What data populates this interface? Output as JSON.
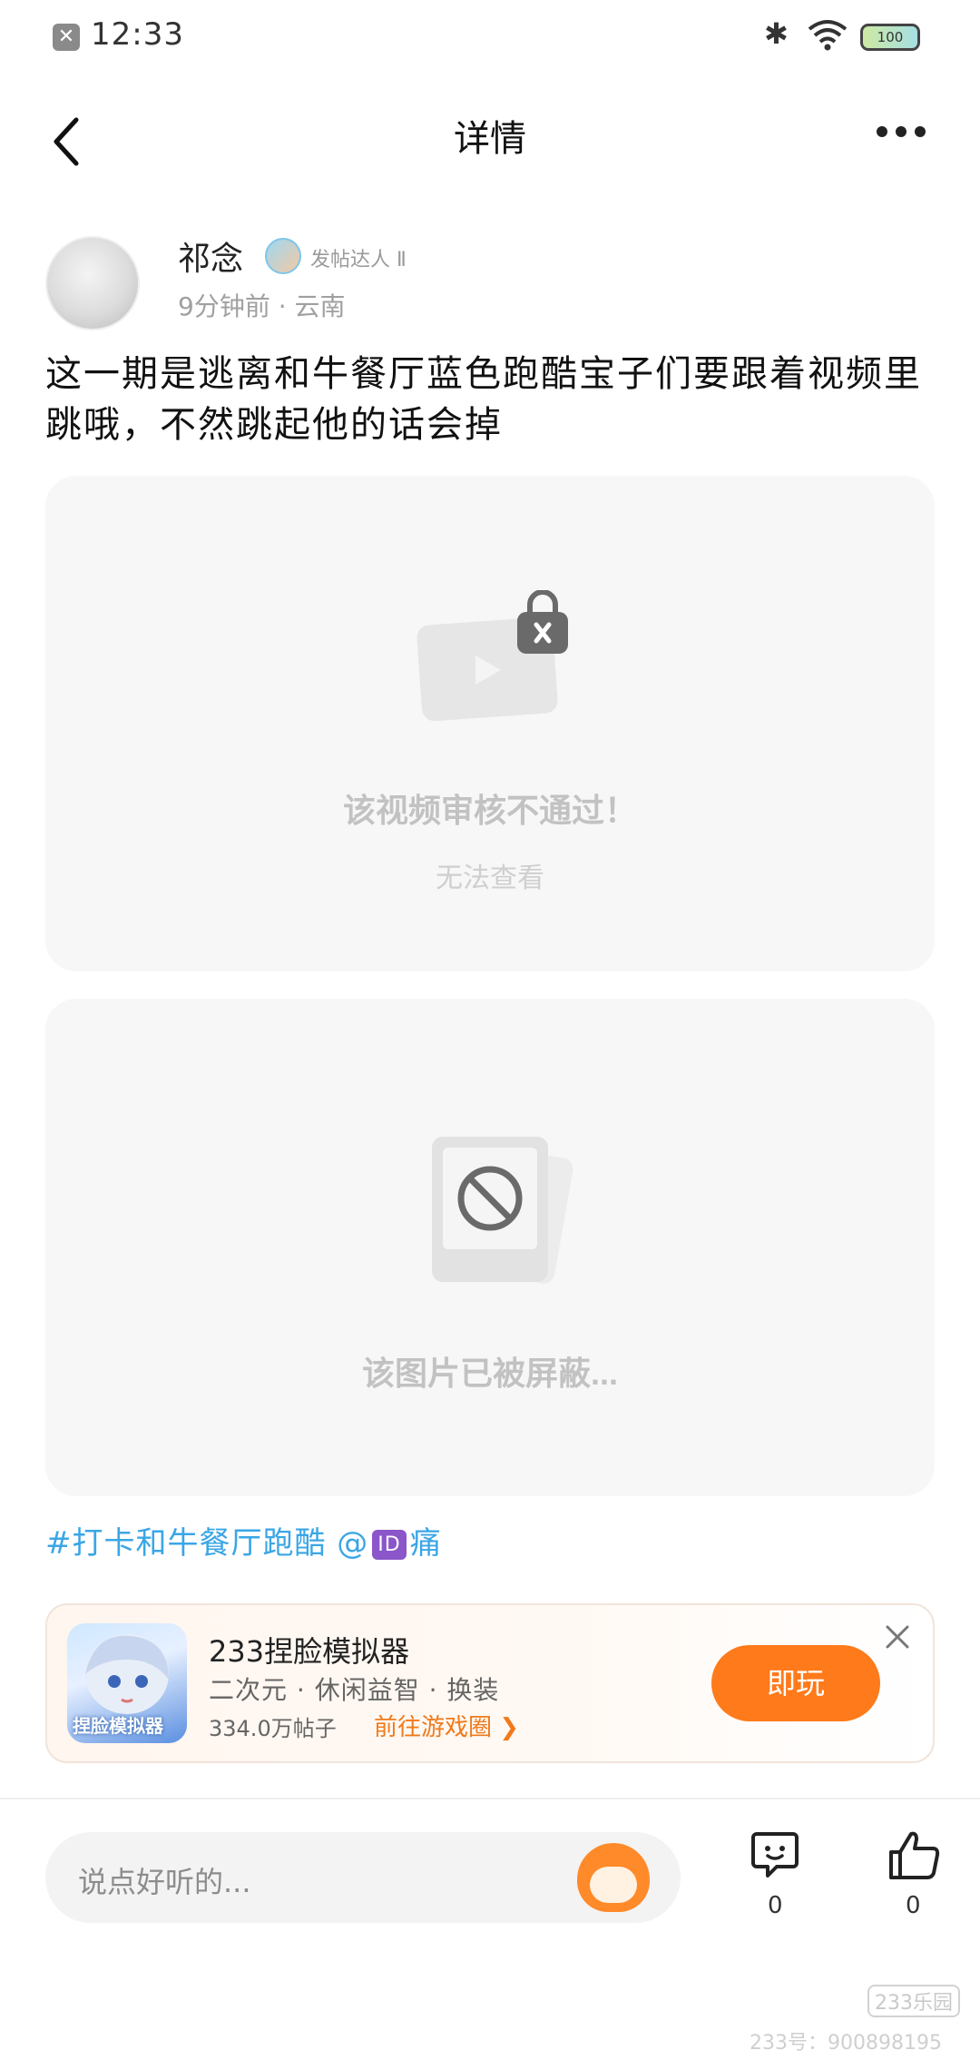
{
  "status_bar": {
    "time": "12:33",
    "battery": "100"
  },
  "header": {
    "title": "详情"
  },
  "post": {
    "author": "祁念",
    "badge": "发帖达人 Ⅱ",
    "meta": "9分钟前 · 云南",
    "text": "这一期是逃离和牛餐厅蓝色跑酷宝子们要跟着视频里跳哦，不然跳起他的话会掉",
    "video_blocked_title": "该视频审核不通过！",
    "video_blocked_sub": "无法查看",
    "image_blocked": "该图片已被屏蔽...",
    "topic_prefix": "#打卡和牛餐厅跑酷 @",
    "topic_emoji": "ID",
    "topic_suffix": "痛"
  },
  "game_card": {
    "name": "233捏脸模拟器",
    "icon_tag": "捏脸模拟器",
    "tags": "二次元 · 休闲益智 · 换装",
    "posts": "334.0万帖子",
    "link": "前往游戏圈",
    "play": "即玩"
  },
  "bottom": {
    "comment_placeholder": "说点好听的...",
    "comment_count": "0",
    "like_count": "0"
  },
  "watermark": {
    "logo": "233乐园",
    "account": "233号：900898195"
  },
  "colors": {
    "accent_orange": "#ff7a1a",
    "topic_blue": "#3aa6e6",
    "card_bg": "#f7f7f7"
  }
}
